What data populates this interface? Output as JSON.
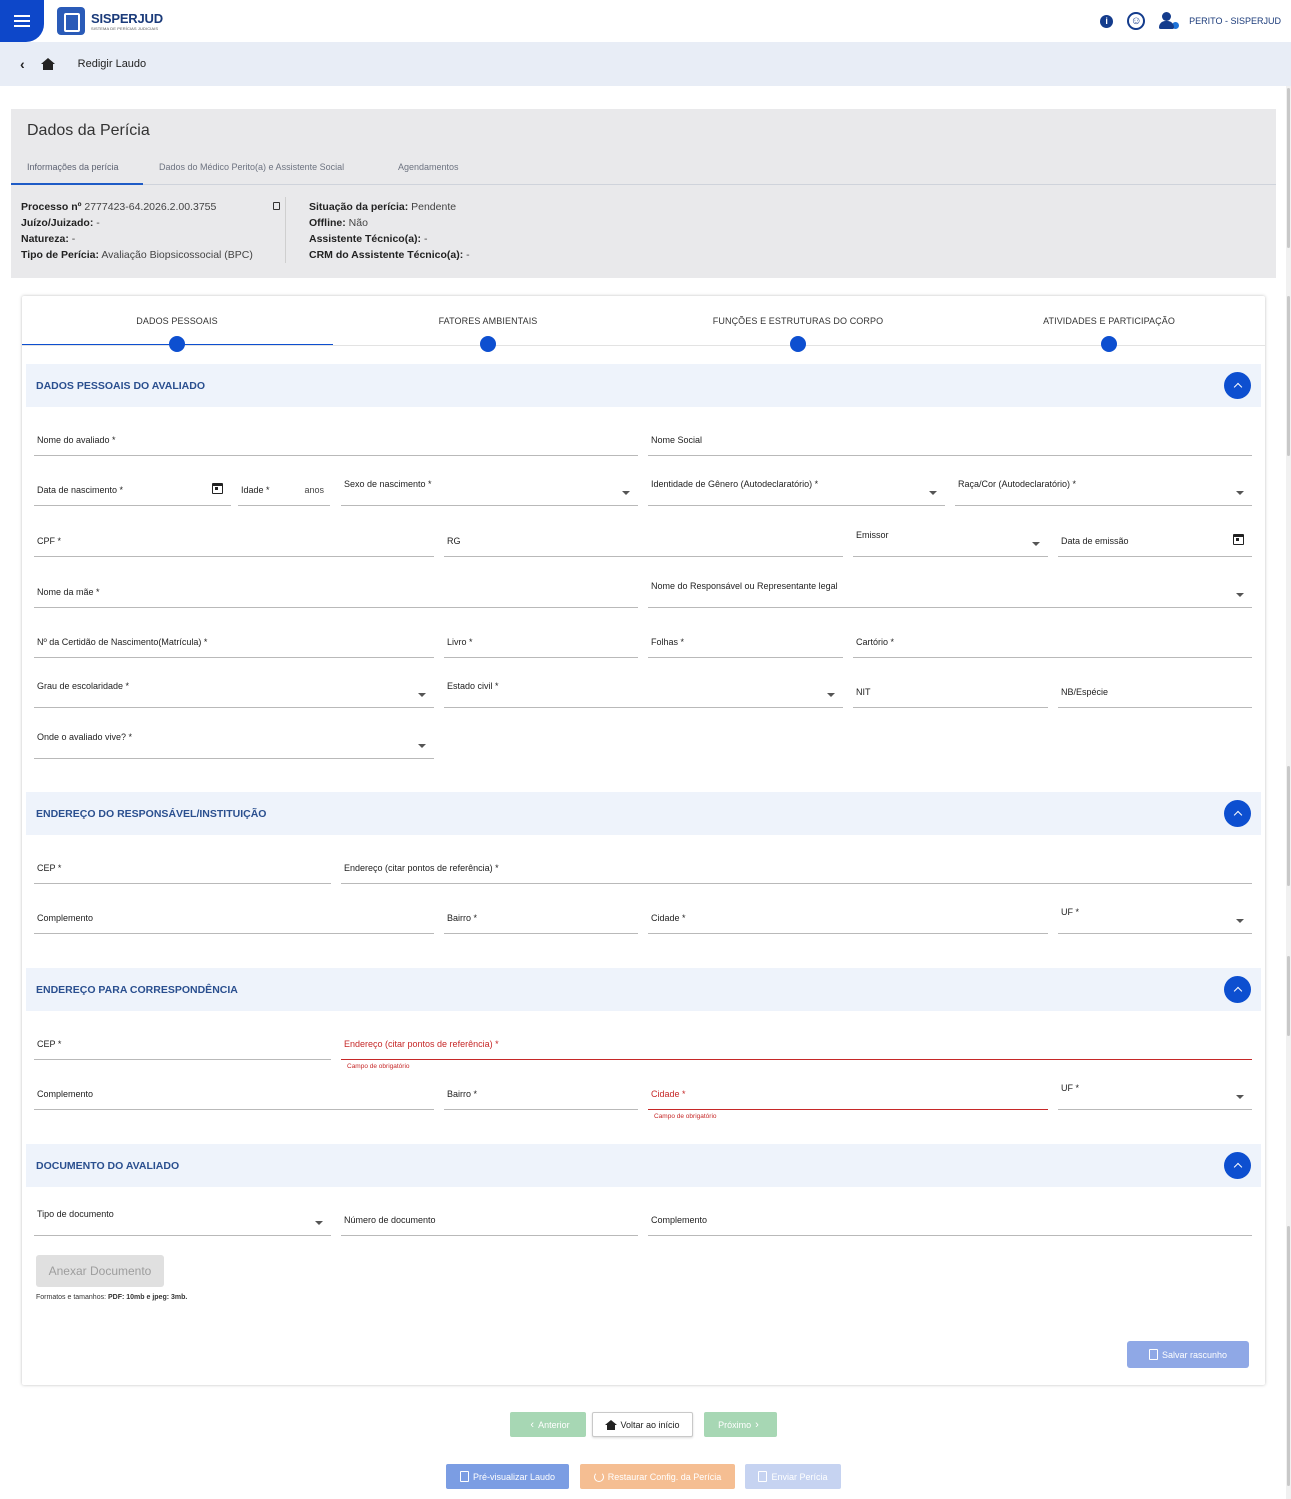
{
  "header": {
    "logo_title": "SISPERJUD",
    "logo_subtitle": "SISTEMA DE PERÍCIAS JUDICIAIS",
    "user_label": "PERITO - SISPERJUD"
  },
  "breadcrumb": {
    "title": "Redigir Laudo"
  },
  "pericia": {
    "title": "Dados da Perícia",
    "tabs": [
      {
        "label": "Informações da perícia"
      },
      {
        "label": "Dados do Médico Perito(a) e Assistente Social"
      },
      {
        "label": "Agendamentos"
      }
    ],
    "left": {
      "processo_label": "Processo nº",
      "processo_value": "2777423-64.2026.2.00.3755",
      "juizo_label": "Juízo/Juizado:",
      "juizo_value": "-",
      "natureza_label": "Natureza:",
      "natureza_value": "-",
      "tipo_label": "Tipo de Perícia:",
      "tipo_value": "Avaliação Biopsicossocial (BPC)"
    },
    "right": {
      "situacao_label": "Situação da perícia:",
      "situacao_value": "Pendente",
      "offline_label": "Offline:",
      "offline_value": "Não",
      "assistente_label": "Assistente Técnico(a):",
      "assistente_value": "-",
      "crm_label": "CRM do Assistente Técnico(a):",
      "crm_value": "-"
    }
  },
  "steps": [
    {
      "label": "DADOS PESSOAIS"
    },
    {
      "label": "FATORES AMBIENTAIS"
    },
    {
      "label": "FUNÇÕES E ESTRUTURAS DO CORPO"
    },
    {
      "label": "ATIVIDADES E PARTICIPAÇÃO"
    }
  ],
  "sections": {
    "pessoais": "DADOS PESSOAIS DO AVALIADO",
    "endereco_resp": "ENDEREÇO DO RESPONSÁVEL/INSTITUIÇÃO",
    "endereco_corr": "ENDEREÇO PARA CORRESPONDÊNCIA",
    "documento": "DOCUMENTO DO AVALIADO"
  },
  "fields": {
    "nome": "Nome do avaliado *",
    "nome_social": "Nome Social",
    "nascimento": "Data de nascimento *",
    "idade": "Idade *",
    "idade_suffix": "anos",
    "sexo": "Sexo de nascimento *",
    "genero": "Identidade de Gênero (Autodeclaratório) *",
    "raca": "Raça/Cor (Autodeclaratório) *",
    "cpf": "CPF *",
    "rg": "RG",
    "emissor": "Emissor",
    "data_emissao": "Data de emissão",
    "mae": "Nome da mãe *",
    "responsavel": "Nome do Responsável ou Representante legal",
    "certidao": "Nº da Certidão de Nascimento(Matrícula) *",
    "livro": "Livro *",
    "folhas": "Folhas *",
    "cartorio": "Cartório *",
    "escolaridade": "Grau de escolaridade *",
    "estado_civil": "Estado civil *",
    "nit": "NIT",
    "nb": "NB/Espécie",
    "onde_vive": "Onde o avaliado vive? *",
    "r_cep": "CEP *",
    "r_endereco": "Endereço (citar pontos de referência) *",
    "r_complemento": "Complemento",
    "r_bairro": "Bairro *",
    "r_cidade": "Cidade *",
    "r_uf": "UF *",
    "c_cep": "CEP *",
    "c_endereco": "Endereço (citar pontos de referência) *",
    "c_complemento": "Complemento",
    "c_bairro": "Bairro *",
    "c_cidade": "Cidade *",
    "c_uf": "UF *",
    "d_tipo": "Tipo de documento",
    "d_numero": "Número de documento",
    "d_complemento": "Complemento"
  },
  "errors": {
    "required": "Campo de obrigatório"
  },
  "attach": {
    "button": "Anexar Documento",
    "formats_prefix": "Formatos e tamanhos:",
    "formats_value": "PDF: 10mb e jpeg: 3mb."
  },
  "actions": {
    "save_draft": "Salvar rascunho",
    "prev": "Anterior",
    "home": "Voltar ao início",
    "next": "Próximo",
    "preview": "Pré-visualizar Laudo",
    "restore": "Restaurar Config. da Perícia",
    "send": "Enviar Perícia"
  }
}
